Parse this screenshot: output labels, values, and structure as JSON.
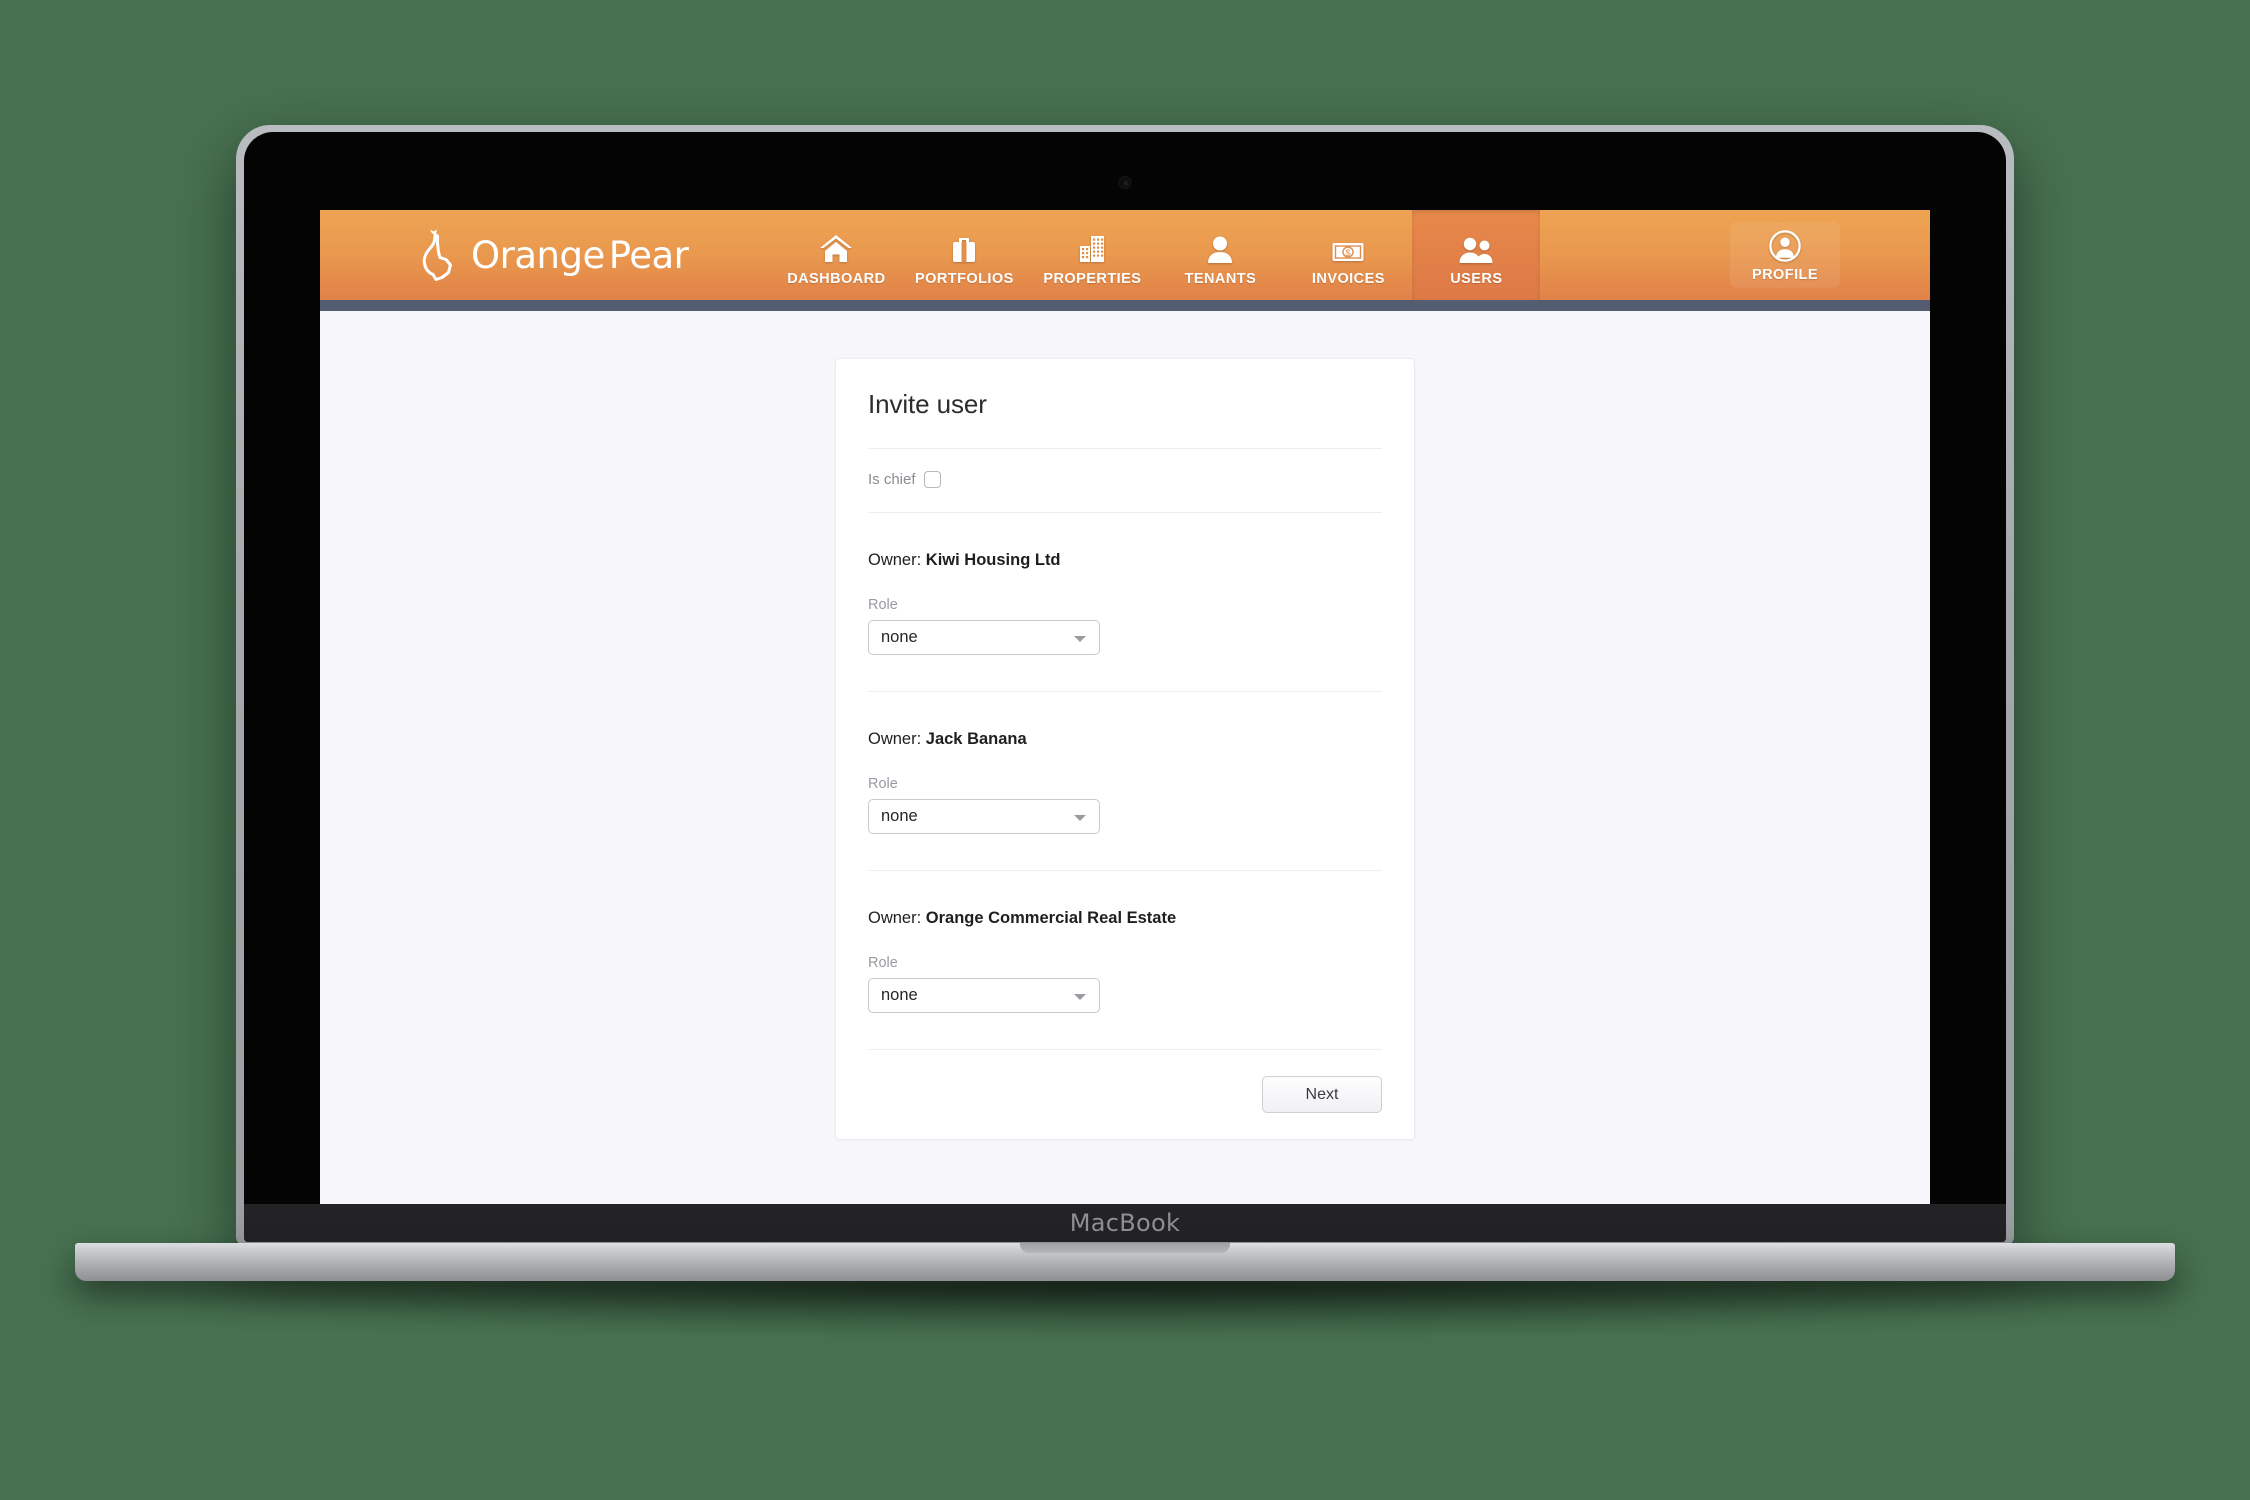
{
  "device": {
    "label": "MacBook"
  },
  "header": {
    "brand": {
      "name_part1": "Orange",
      "name_part2": "Pear",
      "logo_icon": "pear-logo-icon"
    },
    "nav": [
      {
        "label": "DASHBOARD",
        "icon": "home-icon",
        "active": false
      },
      {
        "label": "PORTFOLIOS",
        "icon": "briefcase-icon",
        "active": false
      },
      {
        "label": "PROPERTIES",
        "icon": "buildings-icon",
        "active": false
      },
      {
        "label": "TENANTS",
        "icon": "person-icon",
        "active": false
      },
      {
        "label": "INVOICES",
        "icon": "banknote-icon",
        "active": false
      },
      {
        "label": "USERS",
        "icon": "people-icon",
        "active": true
      }
    ],
    "profile": {
      "label": "PROFILE",
      "icon": "user-circle-icon"
    },
    "colors": {
      "gradient_top": "#eea452",
      "gradient_bottom": "#df7c47",
      "active_tab": "#e2804a",
      "bottom_bar": "#545c70"
    }
  },
  "main": {
    "card_title": "Invite user",
    "is_chief": {
      "label": "Is chief",
      "checked": false
    },
    "role_field_label": "Role",
    "owner_prefix": "Owner:",
    "owners": [
      {
        "name": "Kiwi Housing Ltd",
        "role": "none"
      },
      {
        "name": "Jack Banana",
        "role": "none"
      },
      {
        "name": "Orange Commercial Real Estate",
        "role": "none"
      }
    ],
    "next_label": "Next"
  },
  "theme": {
    "page_background": "#f7f7fb",
    "card_background": "#ffffff",
    "desktop_background": "#477150"
  }
}
